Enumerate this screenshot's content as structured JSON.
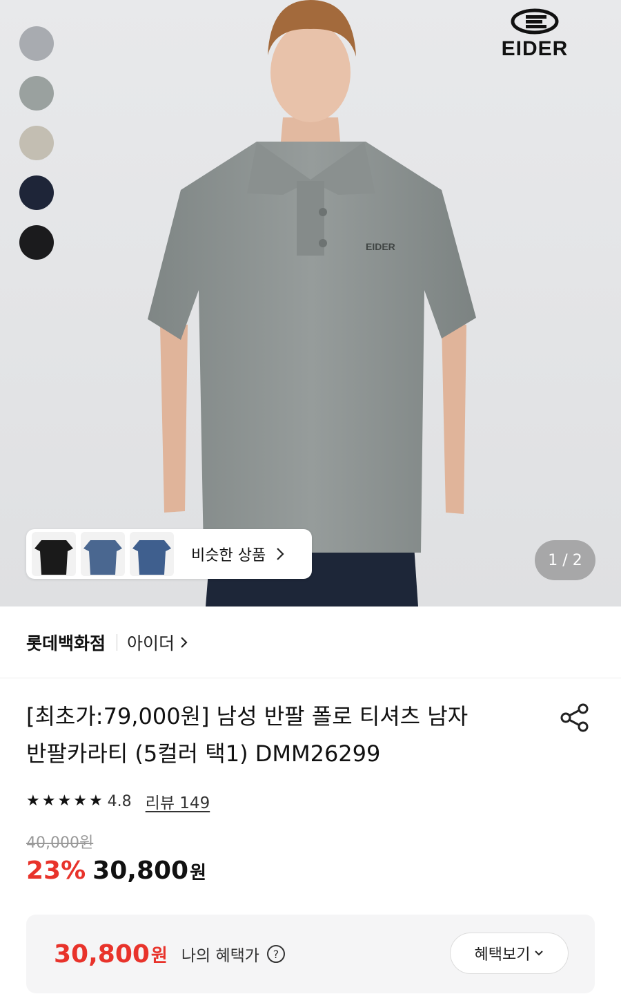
{
  "hero": {
    "brand_logo_text": "EIDER",
    "chest_logo_text": "EIDER",
    "swatches": [
      "#a8abb0",
      "#9aa19f",
      "#c3beb2",
      "#1e2538",
      "#1b1b1d"
    ],
    "similar_products": {
      "label": "비슷한 상품",
      "thumbnails": [
        "#1a1a1a",
        "#4a6790",
        "#3f5f8e"
      ]
    },
    "pager": "1 / 2"
  },
  "store": {
    "name": "롯데백화점",
    "brand": "아이더"
  },
  "product": {
    "title_line1": "[최초가:79,000원] 남성 반팔 폴로 티셔츠 남자",
    "title_line2": "반팔카라티 (5컬러 택1) DMM26299",
    "rating": "4.8",
    "review_label": "리뷰 149",
    "original_price": "40,000원",
    "discount": "23%",
    "sale_price": "30,800",
    "sale_unit": "원"
  },
  "benefit": {
    "price": "30,800",
    "unit": "원",
    "label": "나의 혜택가",
    "button_label": "혜택보기"
  },
  "colors": {
    "accent_red": "#e8332b",
    "hero_bg": "#e6e7e9",
    "shirt": "#8e9493"
  }
}
